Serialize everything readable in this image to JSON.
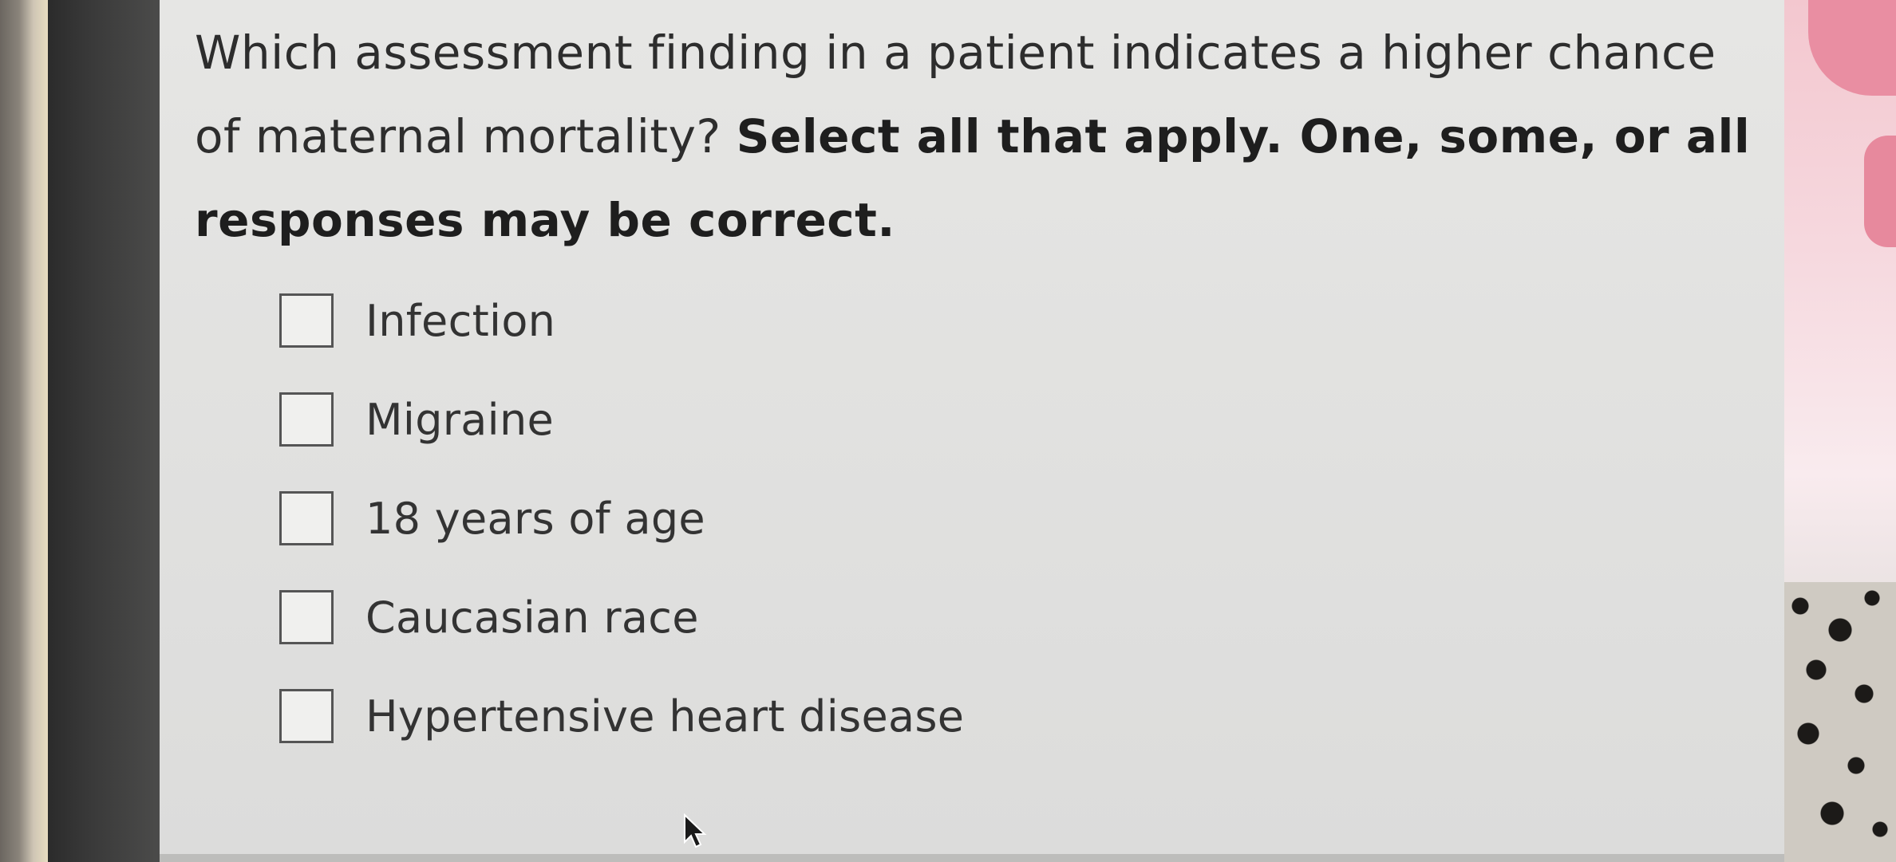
{
  "question": {
    "text": "Which assessment finding in a patient indicates a higher chance of maternal mortality?",
    "instruction": "Select all that apply. One, some, or all responses may be correct."
  },
  "options": [
    {
      "label": "Infection",
      "checked": false
    },
    {
      "label": "Migraine",
      "checked": false
    },
    {
      "label": "18 years of age",
      "checked": false
    },
    {
      "label": "Caucasian race",
      "checked": false
    },
    {
      "label": "Hypertensive heart disease",
      "checked": false
    }
  ],
  "icons": {
    "checkbox": "empty-checkbox-icon",
    "cursor": "mouse-pointer-icon"
  }
}
